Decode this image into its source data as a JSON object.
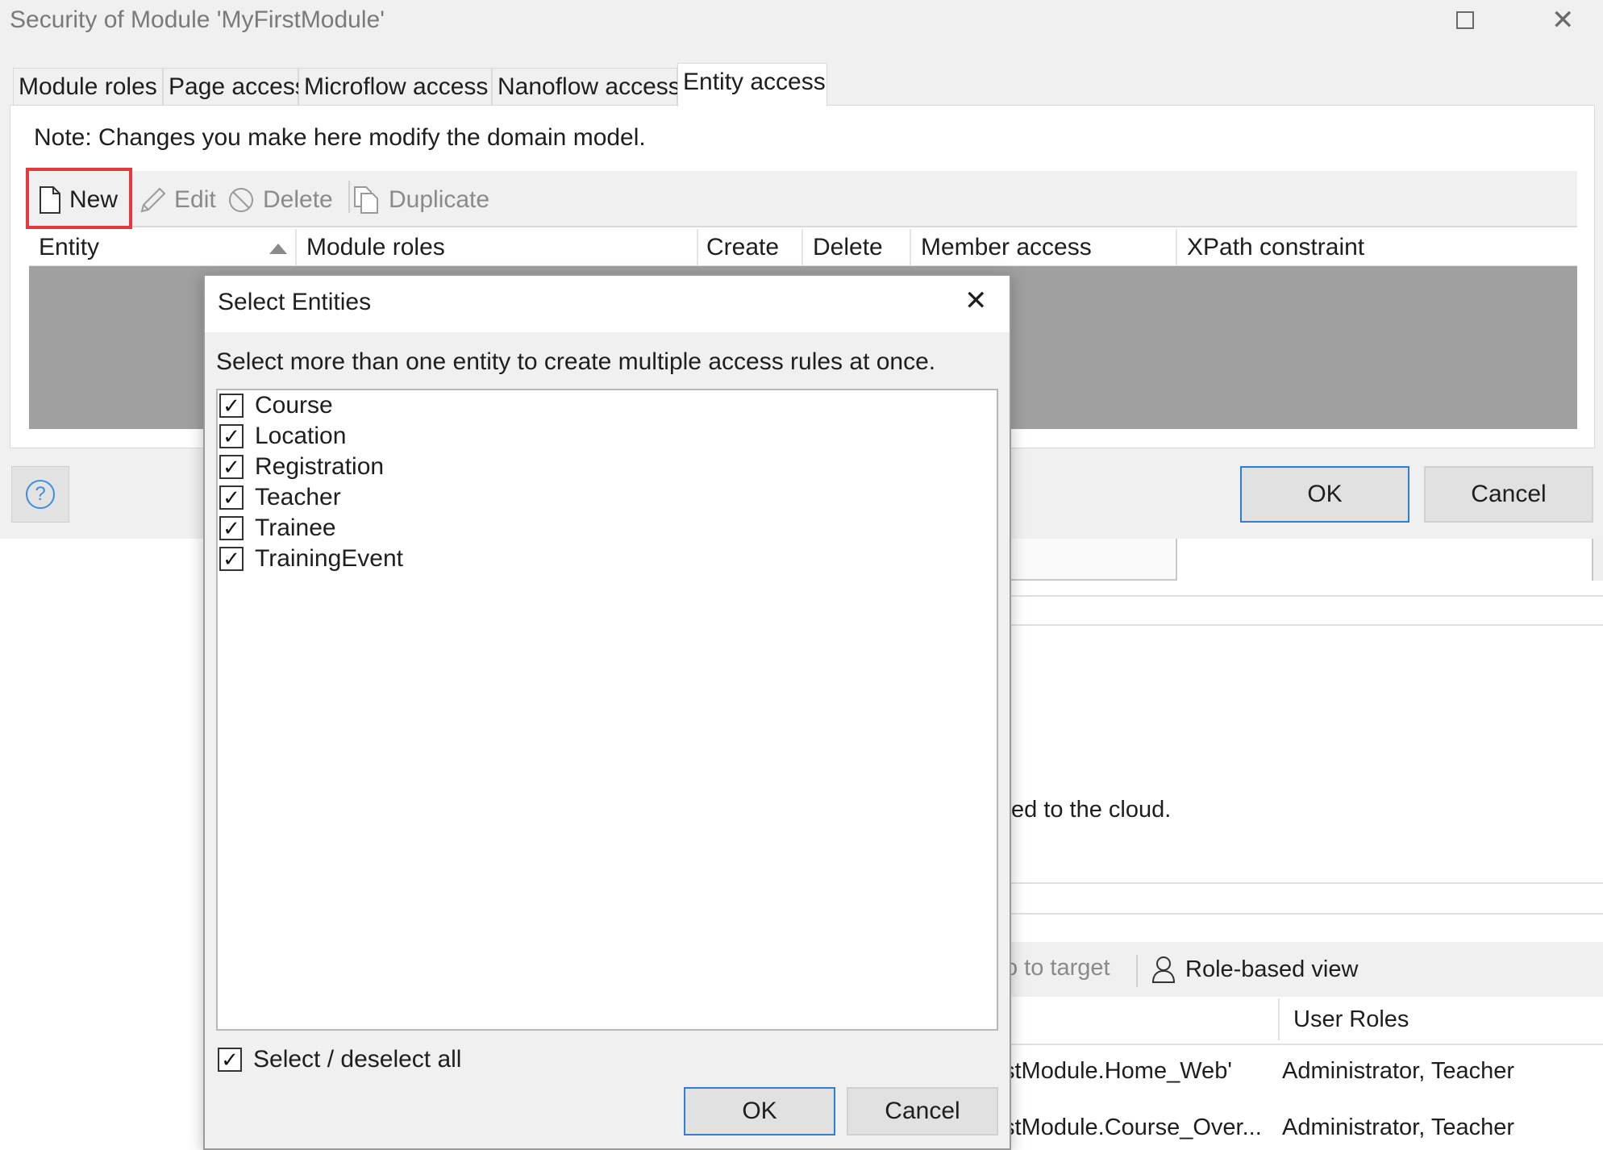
{
  "window": {
    "title": "Security of Module 'MyFirstModule'",
    "maximize_icon": "maximize-icon",
    "close_icon": "close-icon"
  },
  "tabs": [
    {
      "label": "Module roles",
      "active": false
    },
    {
      "label": "Page access",
      "active": false
    },
    {
      "label": "Microflow access",
      "active": false
    },
    {
      "label": "Nanoflow access",
      "active": false
    },
    {
      "label": "Entity access",
      "active": true
    }
  ],
  "panel": {
    "note": "Note: Changes you make here modify the domain model."
  },
  "toolbar": {
    "new_label": "New",
    "edit_label": "Edit",
    "delete_label": "Delete",
    "duplicate_label": "Duplicate",
    "highlight_color": "#e53940"
  },
  "grid": {
    "columns": [
      "Entity",
      "Module roles",
      "Create",
      "Delete",
      "Member access",
      "XPath constraint"
    ],
    "sort_column": "Entity",
    "rows": []
  },
  "footer": {
    "ok_label": "OK",
    "cancel_label": "Cancel",
    "help_icon": "help-icon"
  },
  "background": {
    "cloud_text": "ed to the cloud.",
    "goto_target_label": "o to target",
    "role_view_label": "Role-based view",
    "user_roles_header": "User Roles",
    "rows": [
      {
        "page": "stModule.Home_Web'",
        "roles": "Administrator, Teacher"
      },
      {
        "page": "stModule.Course_Over...",
        "roles": "Administrator, Teacher"
      }
    ]
  },
  "dialog": {
    "title": "Select Entities",
    "instruction": "Select more than one entity to create multiple access rules at once.",
    "entities": [
      {
        "name": "Course",
        "checked": true
      },
      {
        "name": "Location",
        "checked": true
      },
      {
        "name": "Registration",
        "checked": true
      },
      {
        "name": "Teacher",
        "checked": true
      },
      {
        "name": "Trainee",
        "checked": true
      },
      {
        "name": "TrainingEvent",
        "checked": true
      }
    ],
    "select_all_label": "Select / deselect all",
    "select_all_checked": true,
    "ok_label": "OK",
    "cancel_label": "Cancel"
  },
  "colors": {
    "accent_blue": "#2b7fd6",
    "grid_empty_bg": "#a0a0a0"
  }
}
